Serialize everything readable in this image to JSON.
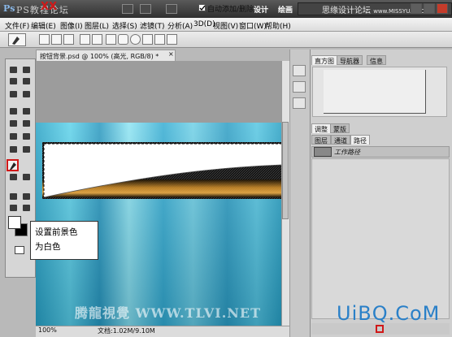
{
  "title_bar": {
    "logo": "Ps",
    "site_watermark": "PS教程论坛",
    "buttons": [
      "设计",
      "绘画"
    ],
    "workspace_watermark": "思缘设计论坛",
    "site_url": "www.MISSYUAN.COM"
  },
  "menu": {
    "items": [
      "文件(F)",
      "编辑(E)",
      "图像(I)",
      "图层(L)",
      "选择(S)",
      "滤镜(T)",
      "分析(A)",
      "3D(D)",
      "视图(V)",
      "窗口(W)",
      "帮助(H)"
    ],
    "marker": "XX"
  },
  "options_bar": {
    "auto_add_delete_label": "自动添加/删除",
    "auto_add_delete_checked": true
  },
  "document": {
    "tab_title": "按钮背景.psd @ 100% (高光, RGB/8) *",
    "close_glyph": "×",
    "zoom": "100%",
    "doc_size": "文档:1.02M/9.10M",
    "watermark": "腾龍視覺 WWW.TLVI.NET"
  },
  "callout": {
    "line1": "设置前景色",
    "line2": "为白色"
  },
  "panels": {
    "top_tabs": [
      "直方图",
      "导航器",
      "信息"
    ],
    "mid_tabs": [
      "调整",
      "蒙版"
    ],
    "bottom_tabs": [
      "图层",
      "通道",
      "路径"
    ],
    "path_item": "工作路径"
  },
  "colors": {
    "foreground": "#ffffff",
    "background": "#000000",
    "highlight_red": "#d01818"
  },
  "corner_watermark": "UiBQ.CoM"
}
